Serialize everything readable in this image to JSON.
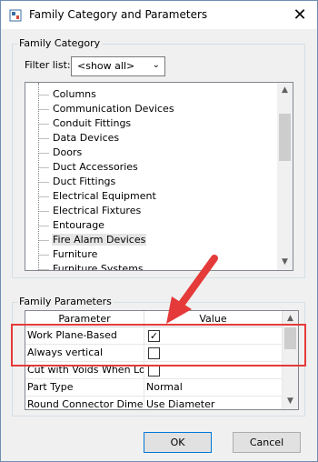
{
  "window": {
    "title": "Family Category and Parameters"
  },
  "category_group": {
    "label": "Family Category",
    "filter_label": "Filter list:",
    "filter_value": "<show all>",
    "items": [
      {
        "label": "Columns",
        "selected": false
      },
      {
        "label": "Communication Devices",
        "selected": false
      },
      {
        "label": "Conduit Fittings",
        "selected": false
      },
      {
        "label": "Data Devices",
        "selected": false
      },
      {
        "label": "Doors",
        "selected": false
      },
      {
        "label": "Duct Accessories",
        "selected": false
      },
      {
        "label": "Duct Fittings",
        "selected": false
      },
      {
        "label": "Electrical Equipment",
        "selected": false
      },
      {
        "label": "Electrical Fixtures",
        "selected": false
      },
      {
        "label": "Entourage",
        "selected": false
      },
      {
        "label": "Fire Alarm Devices",
        "selected": true
      },
      {
        "label": "Furniture",
        "selected": false
      },
      {
        "label": "Furniture Systems",
        "selected": false
      }
    ]
  },
  "parameters_group": {
    "label": "Family Parameters",
    "columns": [
      "Parameter",
      "Value"
    ],
    "rows": [
      {
        "name": "Work Plane-Based",
        "type": "checkbox",
        "checked": true,
        "value": ""
      },
      {
        "name": "Always vertical",
        "type": "checkbox",
        "checked": false,
        "value": ""
      },
      {
        "name": "Cut with Voids When Loaded",
        "type": "checkbox",
        "checked": false,
        "value": ""
      },
      {
        "name": "Part Type",
        "type": "text",
        "checked": false,
        "value": "Normal"
      },
      {
        "name": "Round Connector Dimension",
        "type": "text",
        "checked": false,
        "value": "Use Diameter"
      }
    ]
  },
  "buttons": {
    "ok": "OK",
    "cancel": "Cancel"
  },
  "colors": {
    "annotation": "#e53a3a",
    "accent": "#0078d7"
  },
  "icons": {
    "close": "close-icon",
    "app": "revit-family-icon",
    "annotation_arrow": "red-arrow-icon"
  }
}
